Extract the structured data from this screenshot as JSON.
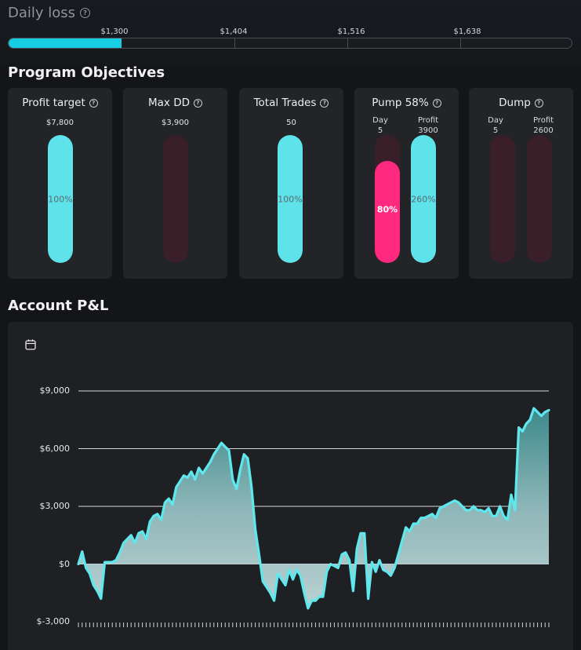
{
  "daily_loss": {
    "title": "Daily loss",
    "fill_fraction": 0.2,
    "markers": [
      {
        "label": "$1,300"
      },
      {
        "label": "$1,404"
      },
      {
        "label": "$1,516"
      },
      {
        "label": "$1,638"
      }
    ]
  },
  "objectives": {
    "title": "Program Objectives",
    "cards": [
      {
        "title": "Profit target",
        "value": "$7,800",
        "percent_label": "100%",
        "percent": 100
      },
      {
        "title": "Max DD",
        "value": "$3,900",
        "percent_label": "",
        "percent": 0
      },
      {
        "title": "Total Trades",
        "value": "50",
        "percent_label": "100%",
        "percent": 100
      },
      {
        "title": "Pump 58%",
        "day_label": "Day",
        "day_value": "5",
        "profit_label": "Profit",
        "profit_value": "3900",
        "day_percent_label": "80%",
        "day_percent": 80,
        "profit_percent_label": "260%",
        "profit_percent": 100
      },
      {
        "title": "Dump",
        "day_label": "Day",
        "day_value": "5",
        "profit_label": "Profit",
        "profit_value": "2600",
        "day_percent": 0,
        "profit_percent": 0
      }
    ]
  },
  "pnl": {
    "title": "Account P&L"
  },
  "icons": {
    "help": "help-circle-icon",
    "calendar": "calendar-icon"
  },
  "colors": {
    "accent": "#17cde4",
    "pill_cyan": "#5ee3ea",
    "pill_pink": "#ff2a7f",
    "pill_empty": "#3a1f29",
    "line": "#5ee8ee"
  },
  "chart_data": {
    "type": "area",
    "title": "",
    "xlabel": "",
    "ylabel": "",
    "ylim": [
      -3000,
      9000
    ],
    "yticks": [
      9000,
      6000,
      3000,
      0,
      -3000
    ],
    "ytick_labels": [
      "$9,000",
      "$6,000",
      "$3,000",
      "$0",
      "$-3,000"
    ],
    "grid": true,
    "series": [
      {
        "values": [
          0,
          650,
          -200,
          -500,
          -1100,
          -1400,
          -1800,
          100,
          100,
          100,
          200,
          600,
          1100,
          1300,
          1500,
          1100,
          1600,
          1700,
          1300,
          2200,
          2500,
          2600,
          2300,
          3200,
          3400,
          3100,
          4000,
          4300,
          4600,
          4500,
          4800,
          4400,
          5000,
          4700,
          5000,
          5300,
          5700,
          6000,
          6300,
          6100,
          5900,
          4400,
          3900,
          4900,
          5700,
          5500,
          4000,
          1800,
          500,
          -900,
          -1200,
          -1500,
          -1900,
          -500,
          -800,
          -1100,
          -300,
          -800,
          -300,
          -600,
          -1500,
          -2300,
          -1900,
          -1900,
          -1700,
          -1700,
          -400,
          0,
          -100,
          -200,
          500,
          600,
          200,
          -1400,
          800,
          1600,
          1600,
          -1800,
          100,
          -400,
          200,
          -300,
          -400,
          -600,
          -200,
          500,
          1200,
          1900,
          1700,
          2100,
          2100,
          2400,
          2400,
          2500,
          2600,
          2400,
          2900,
          3000,
          3100,
          3200,
          3300,
          3200,
          3000,
          2800,
          2800,
          3000,
          2800,
          2800,
          2700,
          2900,
          2500,
          2500,
          3000,
          2500,
          2300,
          3600,
          2800,
          7100,
          6900,
          7300,
          7500,
          8100,
          7900,
          7700,
          7900,
          8000
        ]
      }
    ]
  }
}
